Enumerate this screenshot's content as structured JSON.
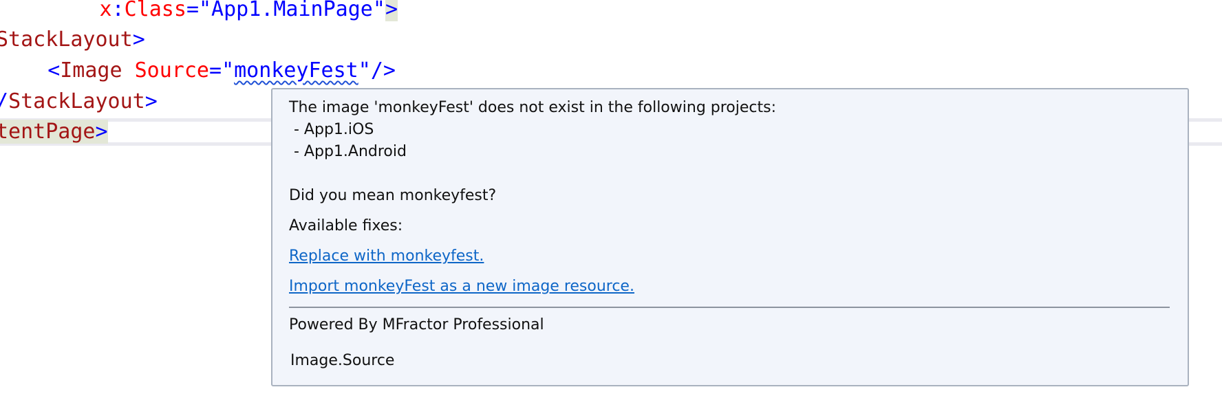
{
  "editor": {
    "line1": {
      "indent": "        ",
      "attr_prefix": "x",
      "colon": ":",
      "attr_name": "Class",
      "eq": "=",
      "value": "\"App1.MainPage\"",
      "close": ">"
    },
    "line2": {
      "tag": "StackLayout",
      "close": ">"
    },
    "line3": {
      "indent": "   ",
      "open": "<",
      "tag": "Image",
      "space": " ",
      "attr": "Source",
      "eq": "=",
      "quote_open": "\"",
      "value": "monkeyFest",
      "quote_close": "\"",
      "close": "/>"
    },
    "line4": {
      "open": "/",
      "tag": "StackLayout",
      "close": ">"
    },
    "line5": {
      "tag": "tentPage",
      "close": ">"
    }
  },
  "tooltip": {
    "message": "The image 'monkeyFest' does not exist in the following projects:",
    "projects": [
      " - App1.iOS",
      " - App1.Android"
    ],
    "suggestion": "Did you mean monkeyfest?",
    "fixes_label": "Available fixes:",
    "fixes": [
      "Replace with monkeyfest.",
      "Import monkeyFest as a new image resource."
    ],
    "powered_by": "Powered By MFractor Professional",
    "symbol": "Image.Source"
  }
}
